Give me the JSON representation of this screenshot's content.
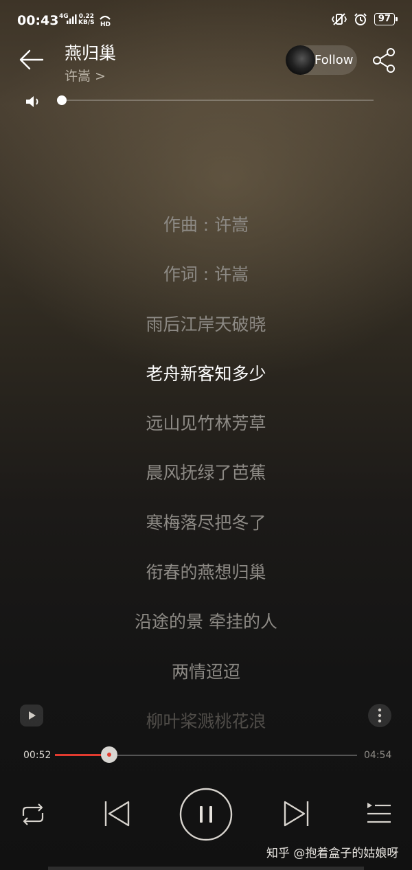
{
  "status_bar": {
    "time": "00:43",
    "network": "4G",
    "speed_value": "0.22",
    "speed_unit": "KB/S",
    "hd": "HD",
    "battery": "97"
  },
  "header": {
    "song_title": "燕归巢",
    "artist": "许嵩 >",
    "follow_label": "Follow"
  },
  "volume": {
    "level": 0.0
  },
  "lyrics": [
    "作曲 : 许嵩",
    "作词 : 许嵩",
    "雨后江岸天破晓",
    "老舟新客知多少",
    "远山见竹林芳草",
    "晨风抚绿了芭蕉",
    "寒梅落尽把冬了",
    "衔春的燕想归巢",
    "沿途的景 牵挂的人",
    "两情迢迢",
    "柳叶桨溅桃花浪"
  ],
  "current_lyric_index": 3,
  "playback": {
    "current_time": "00:52",
    "total_time": "04:54",
    "progress_fraction": 0.18,
    "state": "playing"
  },
  "watermark": "知乎 @抱着盒子的姑娘呀",
  "colors": {
    "accent": "#e23b2f",
    "text_inactive": "#8d8a85",
    "text_active": "#ffffff"
  }
}
